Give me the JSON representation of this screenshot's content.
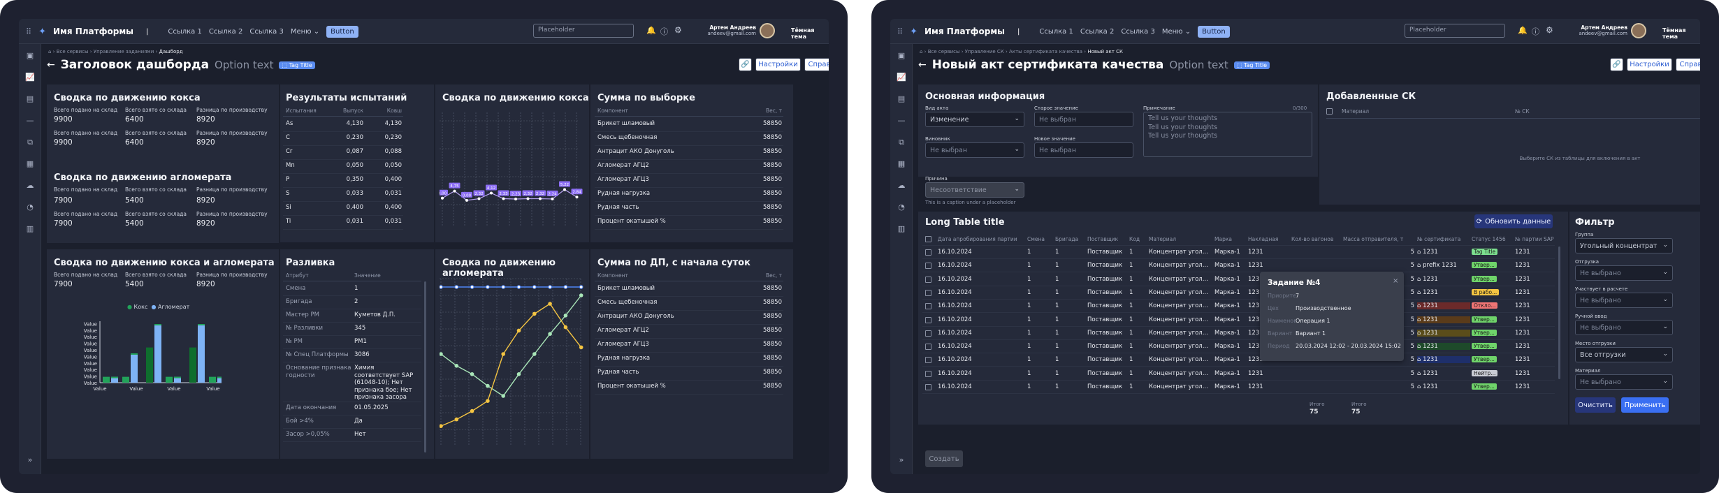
{
  "common": {
    "platform_name": "Имя Платформы",
    "links": [
      "Ссылка 1",
      "Ссылка 2",
      "Ссылка 3"
    ],
    "menu_label": "Меню",
    "button_label": "Button",
    "search_placeholder": "Placeholder",
    "user_name": "Артем Андреев",
    "user_email": "andeev@gmail.com",
    "theme_label": "Тёмная тема",
    "tag_title": "Tag Title",
    "option_text": "Option text",
    "settings_label": "Настройки",
    "help_label": "Справка"
  },
  "dashboard": {
    "breadcrumbs": [
      "Все сервисы",
      "Управление заданиями",
      "Дашборд"
    ],
    "title": "Заголовок дашборда",
    "coke_summary": {
      "title": "Сводка по движению кокса",
      "labels": [
        "Всего подано на склад",
        "Всего взято со склада",
        "Разница по производству"
      ],
      "rows": [
        [
          "9900",
          "6400",
          "8920"
        ],
        [
          "9900",
          "6400",
          "8920"
        ]
      ]
    },
    "agglo_summary": {
      "title": "Сводка по движению агломерата",
      "labels": [
        "Всего подано на склад",
        "Всего взято со склада",
        "Разница по производству"
      ],
      "rows": [
        [
          "7900",
          "5400",
          "8920"
        ],
        [
          "7900",
          "5400",
          "8920"
        ]
      ]
    },
    "coke_agglo_summary": {
      "title": "Сводка по движению кокса и агломерата",
      "labels": [
        "Всего подано на склад",
        "Всего взято со склада",
        "Разница по производству"
      ],
      "values": [
        "7900",
        "5400",
        "8920"
      ],
      "legend": [
        "Кокс",
        "Агломерат"
      ],
      "ytick": "Value",
      "xtick": "Value"
    },
    "test_results": {
      "title": "Результаты испытаний",
      "headers": [
        "Испытания",
        "Выпуск",
        "Ковш"
      ],
      "rows": [
        [
          "As",
          "4,130",
          "4,130"
        ],
        [
          "C",
          "0,230",
          "0,230"
        ],
        [
          "Cr",
          "0,087",
          "0,088"
        ],
        [
          "Mn",
          "0,050",
          "0,050"
        ],
        [
          "P",
          "0,350",
          "0,400"
        ],
        [
          "S",
          "0,033",
          "0,031"
        ],
        [
          "Si",
          "0,400",
          "0,400"
        ],
        [
          "Ti",
          "0,031",
          "0,031"
        ]
      ]
    },
    "razlivka": {
      "title": "Разливка",
      "headers": [
        "Атрибут",
        "Значение"
      ],
      "rows": [
        [
          "Смена",
          "1"
        ],
        [
          "Бригада",
          "2"
        ],
        [
          "Мастер РМ",
          "Куметов Д.П."
        ],
        [
          "№ Разливки",
          "345"
        ],
        [
          "№ РМ",
          "РМ1"
        ],
        [
          "№ Спец Платформы",
          "3086"
        ],
        [
          "Основание признака годности",
          "Химия соответствует SAP (61048-10); Нет признака бое; Нет признака засора"
        ],
        [
          "Дата окончания",
          "01.05.2025"
        ],
        [
          "Бой >4%",
          "Да"
        ],
        [
          "Засор >0,05%",
          "Нет"
        ]
      ]
    },
    "coke_chart": {
      "title": "Сводка по движению кокса",
      "labels": [
        "0,00",
        "4,75",
        "0,00",
        "2,32",
        "4,12",
        "2,33",
        "2,23",
        "2,32",
        "2,32",
        "2,24",
        "5,22",
        "2,84"
      ]
    },
    "agglo_chart": {
      "title": "Сводка по движению агломерата"
    },
    "sum_selection": {
      "title": "Сумма по выборке",
      "headers": [
        "Компонент",
        "Вес, т"
      ],
      "rows": [
        [
          "Брикет шламовый",
          "58850"
        ],
        [
          "Смесь щебеночная",
          "58850"
        ],
        [
          "Антрацит АКО Донуголь",
          "58850"
        ],
        [
          "Агломерат АГЦ2",
          "58850"
        ],
        [
          "Агломерат АГЦ3",
          "58850"
        ],
        [
          "Рудная нагрузка",
          "58850"
        ],
        [
          "Рудная часть",
          "58850"
        ],
        [
          "Процент окатышей %",
          "58850"
        ]
      ]
    },
    "sum_dp": {
      "title": "Сумма по ДП, с начала суток",
      "headers": [
        "Компонент",
        "Вес, т"
      ],
      "rows": [
        [
          "Брикет шламовый",
          "58850"
        ],
        [
          "Смесь щебеночная",
          "58850"
        ],
        [
          "Антрацит АКО Донуголь",
          "58850"
        ],
        [
          "Агломерат АГЦ2",
          "58850"
        ],
        [
          "Агломерат АГЦ3",
          "58850"
        ],
        [
          "Рудная нагрузка",
          "58850"
        ],
        [
          "Рудная часть",
          "58850"
        ],
        [
          "Процент окатышей %",
          "58850"
        ]
      ]
    }
  },
  "cert": {
    "breadcrumbs": [
      "Все сервисы",
      "Управление СК",
      "Акты сертификата качества",
      "Новый акт СК"
    ],
    "title": "Новый акт сертификата качества",
    "main_info_title": "Основная информация",
    "act_type_label": "Вид акта",
    "act_type_value": "Изменение",
    "old_value_label": "Старое значение",
    "old_value_value": "Не выбран",
    "culprit_label": "Виновник",
    "culprit_value": "Не выбран",
    "new_value_label": "Новое значение",
    "new_value_value": "Не выбран",
    "reason_label": "Причина",
    "reason_value": "Несоответствие",
    "reason_caption": "This is a caption under a placeholder",
    "note_label": "Примечание",
    "note_counter": "0/300",
    "note_lines": [
      "Tell us your thoughts",
      "Tell us your thoughts",
      "Tell us your thoughts"
    ],
    "added_title": "Добавленные СК",
    "added_headers": [
      "Материал",
      "№ СК"
    ],
    "added_empty": "Выберите СК из таблицы для включения в акт",
    "long_table_title": "Long Table title",
    "refresh_label": "Обновить данные",
    "table_headers": [
      "Дата апробирования партии",
      "Смена",
      "Бригада",
      "Поставщик",
      "Код",
      "Материал",
      "Марка",
      "Накладная",
      "Кол-во вагонов",
      "Масса отправителя, т",
      "№ сертификата",
      "Статус 1456",
      "№ партии SAP"
    ],
    "table_rows": [
      [
        "16.10.2024",
        "1",
        "1",
        "Поставщик",
        "1",
        "Концентрат угол...",
        "Марка-1",
        "1231",
        "",
        "5",
        "1231",
        "Tag Title",
        "1231"
      ],
      [
        "16.10.2024",
        "1",
        "1",
        "Поставщик",
        "1",
        "Концентрат угол...",
        "Марка-1",
        "1231",
        "",
        "5",
        "prefix 1231",
        "Утвер...",
        "1231"
      ],
      [
        "16.10.2024",
        "1",
        "1",
        "Поставщик",
        "1",
        "Концентрат угол...",
        "Марка-1",
        "1231",
        "",
        "5",
        "1231",
        "Утвер...",
        "1231"
      ],
      [
        "16.10.2024",
        "1",
        "1",
        "Поставщик",
        "1",
        "Концентрат угол...",
        "Марка-1",
        "1231",
        "",
        "5",
        "1231",
        "В рабо...",
        "1231"
      ],
      [
        "16.10.2024",
        "1",
        "1",
        "Поставщик",
        "1",
        "Концентрат угол...",
        "Марка-1",
        "1231",
        "",
        "5",
        "1231",
        "Откло...",
        "1231"
      ],
      [
        "16.10.2024",
        "1",
        "1",
        "Поставщик",
        "1",
        "Концентрат угол...",
        "Марка-1",
        "1231",
        "",
        "5",
        "1231",
        "Утвер...",
        "1231"
      ],
      [
        "16.10.2024",
        "1",
        "1",
        "Поставщик",
        "1",
        "Концентрат угол...",
        "Марка-1",
        "1231",
        "",
        "5",
        "1231",
        "Утвер...",
        "1231"
      ],
      [
        "16.10.2024",
        "1",
        "1",
        "Поставщик",
        "1",
        "Концентрат угол...",
        "Марка-1",
        "1231",
        "",
        "5",
        "1231",
        "Утвер...",
        "1231"
      ],
      [
        "16.10.2024",
        "1",
        "1",
        "Поставщик",
        "1",
        "Концентрат угол...",
        "Марка-1",
        "1231",
        "",
        "5",
        "1231",
        "Утвер...",
        "1231"
      ],
      [
        "16.10.2024",
        "1",
        "1",
        "Поставщик",
        "1",
        "Концентрат угол...",
        "Марка-1",
        "1231",
        "",
        "5",
        "1231",
        "Нейтр...",
        "1231"
      ],
      [
        "16.10.2024",
        "1",
        "1",
        "Поставщик",
        "1",
        "Концентрат угол...",
        "Марка-1",
        "1231",
        "",
        "5",
        "1231",
        "Утвер...",
        "1231"
      ]
    ],
    "total_label": "Итого",
    "totals": [
      "75",
      "75"
    ],
    "popup": {
      "title": "Задание №4",
      "rows": [
        [
          "Приоритет",
          "7"
        ],
        [
          "Цех",
          "Производственное"
        ],
        [
          "Наименование",
          "Операция 1"
        ],
        [
          "Вариант",
          "Вариант 1"
        ],
        [
          "Период",
          "20.03.2024 12:02 - 20.03.2024 15:02"
        ]
      ]
    },
    "filter_title": "Фильтр",
    "filters": [
      {
        "label": "Группа",
        "value": "Угольный концентрат"
      },
      {
        "label": "Отгрузка",
        "value": "Не выбрано"
      },
      {
        "label": "Участвует в расчете",
        "value": "Не выбрано"
      },
      {
        "label": "Ручной ввод",
        "value": "Не выбрано"
      },
      {
        "label": "Место отгрузки",
        "value": "Все отгрузки"
      },
      {
        "label": "Материал",
        "value": "Не выбрано"
      }
    ],
    "clear_label": "Очистить",
    "apply_label": "Применить",
    "create_label": "Создать"
  },
  "chart_data": [
    {
      "type": "bar",
      "series": [
        {
          "name": "Кокс",
          "values": [
            1.0,
            1.0,
            1.0,
            1.0,
            1.0,
            1.0
          ],
          "color": "#22a35a"
        },
        {
          "name": "Агломерат",
          "values": [
            1.0,
            5.0,
            10.0,
            1.0,
            10.0,
            1.0
          ],
          "color": "#7eb3f5"
        }
      ],
      "coke_top": [
        0.2,
        0.2,
        6.0,
        0.2,
        6.0,
        0.2
      ]
    },
    {
      "type": "line",
      "x": [
        1,
        2,
        3,
        4,
        5,
        6,
        7,
        8,
        9,
        10,
        11,
        12
      ],
      "values": [
        2.5,
        4.75,
        1.8,
        2.32,
        4.12,
        2.33,
        2.23,
        2.32,
        2.32,
        2.24,
        5.22,
        2.84
      ]
    },
    {
      "type": "line",
      "x": [
        1,
        2,
        3,
        4,
        5,
        6,
        7,
        8,
        9,
        10
      ],
      "series": [
        {
          "name": "blue",
          "values": [
            8.5,
            8.5,
            8.5,
            8.5,
            8.5,
            8.5,
            8.5,
            8.5,
            8.5,
            8.5
          ],
          "color": "#4f86f7"
        },
        {
          "name": "green",
          "values": [
            4.5,
            3.8,
            3.3,
            2.6,
            2.0,
            3.3,
            4.5,
            5.7,
            6.8,
            8.0
          ],
          "color": "#a9e6b8"
        },
        {
          "name": "yellow",
          "values": [
            0.2,
            0.6,
            1.1,
            1.7,
            4.5,
            5.9,
            6.9,
            7.5,
            6.1,
            4.9
          ],
          "color": "#f5c542"
        }
      ]
    }
  ]
}
